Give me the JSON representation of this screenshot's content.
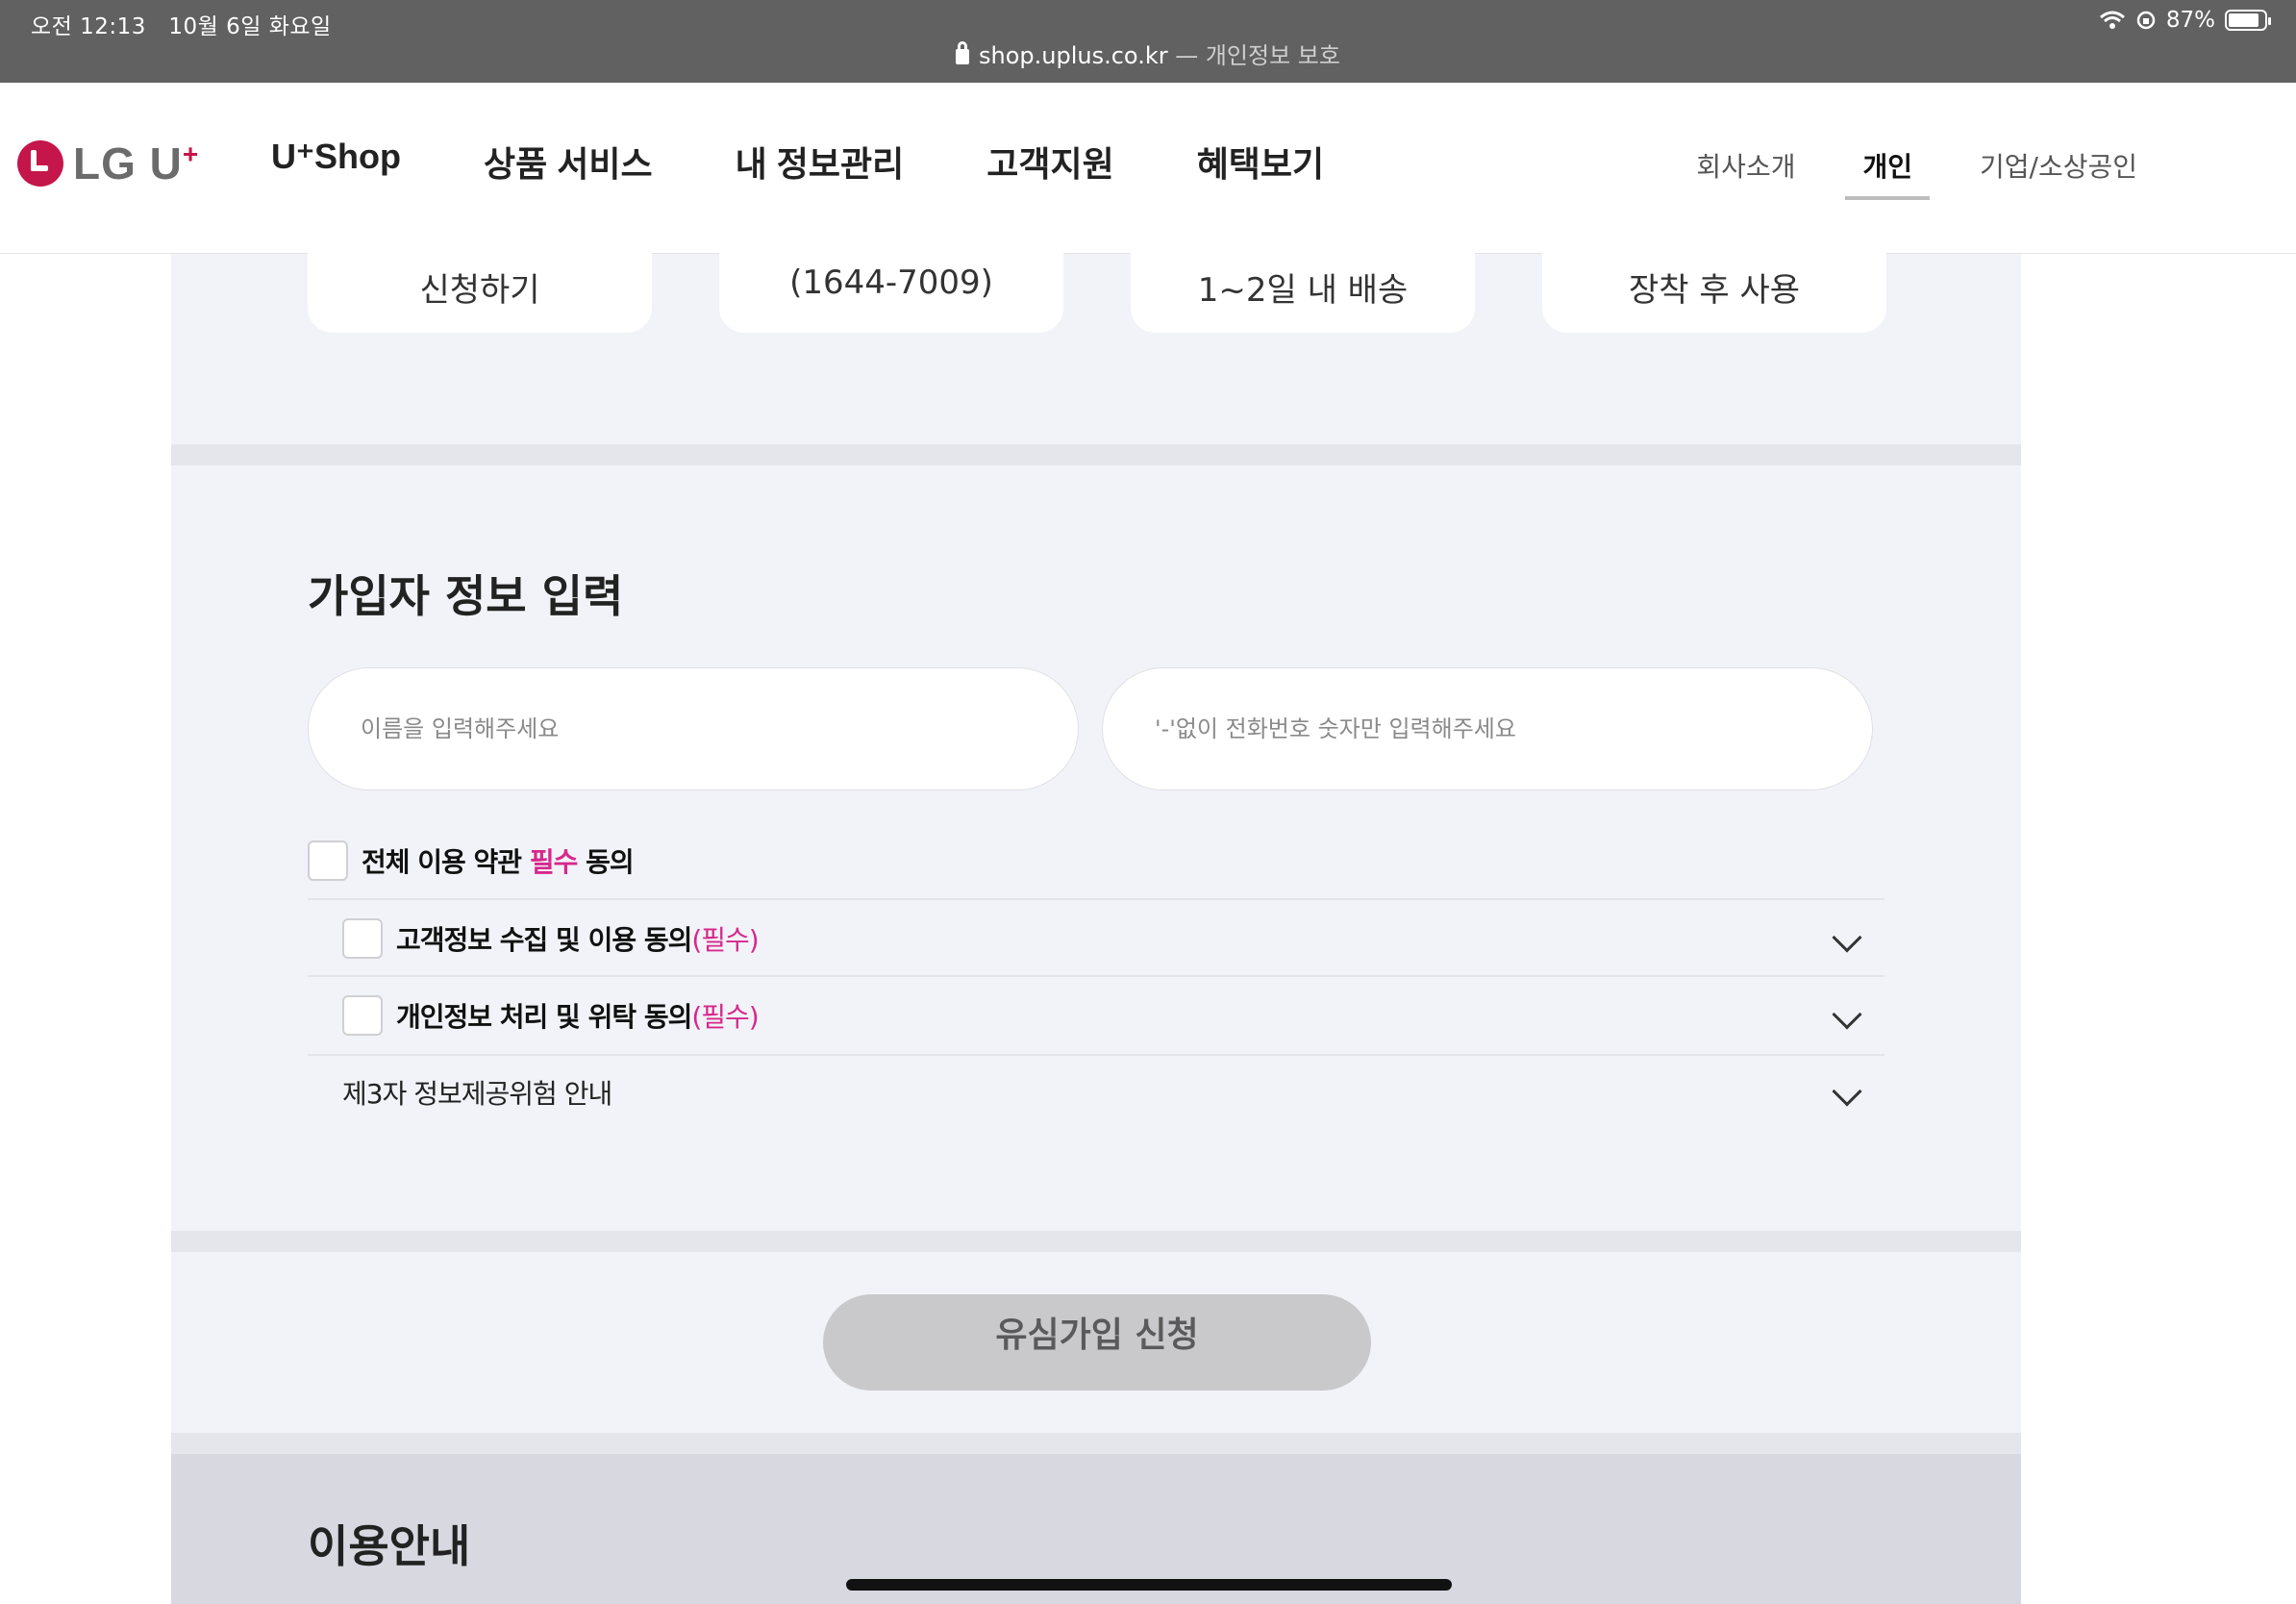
{
  "status_bar": {
    "time": "오전 12:13",
    "date": "10월 6일 화요일",
    "battery": "87%",
    "url": "shop.uplus.co.kr",
    "url_suffix": " — 개인정보 보호"
  },
  "header": {
    "logo": "LG U+",
    "nav": [
      "U⁺Shop",
      "상품 서비스",
      "내 정보관리",
      "고객지원",
      "혜택보기"
    ],
    "util": [
      "회사소개",
      "개인",
      "기업/소상공인"
    ]
  },
  "steps": [
    "신청하기",
    "(1644-7009)",
    "1~2일 내 배송",
    "장착 후 사용"
  ],
  "form": {
    "title": "가입자 정보 입력",
    "name_placeholder": "이름을 입력해주세요",
    "phone_placeholder": "'-'없이 전화번호 숫자만 입력해주세요",
    "agree_all_prefix": "전체 이용 약관 ",
    "agree_all_required": "필수",
    "agree_all_suffix": " 동의",
    "agree_items": [
      {
        "label": "고객정보 수집 및 이용 동의",
        "required": "(필수)"
      },
      {
        "label": "개인정보 처리 및 위탁 동의",
        "required": "(필수)"
      }
    ],
    "third_party": "제3자 정보제공위험 안내",
    "submit": "유심가입 신청"
  },
  "guide": {
    "title": "이용안내"
  },
  "colors": {
    "brand": "#c4164a",
    "required_pink": "#d6288c",
    "content_bg": "#f2f3f8"
  }
}
